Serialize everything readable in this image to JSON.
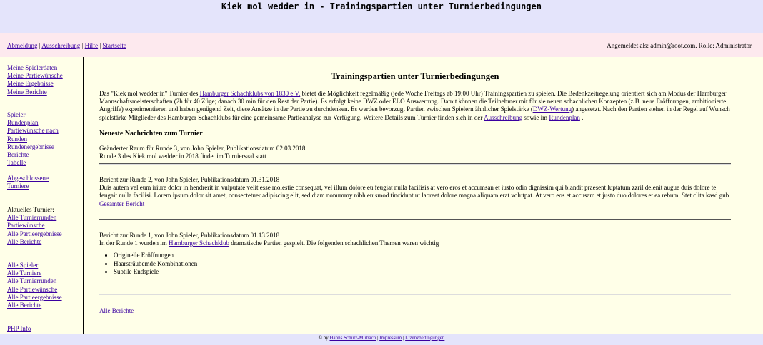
{
  "header": {
    "title": "Kiek mol wedder in - Trainingspartien unter Turnierbedingungen"
  },
  "nav": {
    "links": [
      "Abmeldung",
      "Ausschreibung",
      "Hilfe",
      "Startseite"
    ],
    "separator": " | ",
    "login_text": "Angemeldet als: admin@root.com. Rolle: Administrator"
  },
  "sidebar": {
    "group1": [
      "Meine Spielerdaten",
      "Meine Partiewünsche",
      "Meine Ergebnisse",
      "Meine Berichte"
    ],
    "group2": [
      "Spieler",
      "Rundenplan",
      "Partiewünsche nach Runden",
      "Rundenergebnisse",
      "Berichte",
      "Tabelle"
    ],
    "group3": [
      "Abgeschlossene Turniere"
    ],
    "current_label": "Aktuelles Turnier:",
    "group4": [
      "Alle Turnierrunden",
      "Partiewünsche",
      "Alle Partieergebnisse",
      "Alle Berichte"
    ],
    "group5": [
      "Alle Spieler",
      "Alle Turniere",
      "Alle Turnierrunden",
      "Alle Partiewünsche",
      "Alle Partieergebnisse",
      "Alle Berichte"
    ],
    "group6": [
      "PHP Info"
    ]
  },
  "main": {
    "title": "Trainingspartien unter Turnierbedingungen",
    "intro": {
      "p1": "Das \"Kiek mol wedder in\" Turnier des ",
      "link1": "Hamburger Schachklubs von 1830 e.V.",
      "p2": " bietet die Möglichkeit regelmäßig (jede Woche Freitags ab 19:00 Uhr) Trainingspartien zu spielen. Die Bedenkzeitregelung orientiert sich am Modus der Hamburger Mannschaftsmeisterschaften (2h für 40 Züge; danach 30 min für den Rest der Partie). Es erfolgt keine DWZ oder ELO Auswertung. Damit können die Teilnehmer mit für sie neuen schachlichen Konzepten (z.B. neue Eröffnungen, ambitionierte Angriffe) experimentieren und haben genügend Zeit, diese Ansätze in der Partie zu durchdenken. Es werden bevorzugt Partien zwischen Spielern ähnlicher Spielstärke (",
      "link2": "DWZ-Wertung",
      "p3": ") angesetzt. Nach den Partien stehen in der Regel auf Wunsch spielstärke Mitglieder des Hamburger Schachklubs für eine gemeinsame Partieanalyse zur Verfügung. Weitere Details zum Turnier finden sich in der ",
      "link3": "Ausschreibung",
      "p4": " sowie im ",
      "link4": "Rundenplan",
      "p5": " ."
    },
    "news_heading": "Neueste Nachrichten zum Turnier",
    "news": [
      {
        "headline": "Geänderter Raum für Runde 3, von John Spieler, Publikationsdatum 02.03.2018",
        "body": "Runde 3 des Kiek mol wedder in 2018 findet im Turniersaal statt"
      },
      {
        "headline": "Bericht zur Runde 2, von John Spieler, Publikationsdatum 01.31.2018",
        "body": "Duis autem vel eum iriure dolor in hendrerit in vulputate velit esse molestie consequat, vel illum dolore eu feugiat nulla facilisis at vero eros et accumsan et iusto odio dignissim qui blandit praesent luptatum zzril delenit augue duis dolore te feugait nulla facilisi. Lorem ipsum dolor sit amet, consectetuer adipiscing elit, sed diam nonummy nibh euismod tincidunt ut laoreet dolore magna aliquam erat volutpat. At vero eos et accusam et justo duo dolores et ea rebum. Stet clita kasd gub",
        "more": "Gesamter Bericht"
      },
      {
        "headline": "Bericht zur Runde 1, von John Spieler, Publikationsdatum 01.13.2018",
        "body_pre": "In der Runde 1 wurden im ",
        "body_link": "Hamburger Schachklub",
        "body_post": " dramatische Partien gespielt. Die folgenden schachlichen Themen waren wichtig",
        "items": [
          "Originelle Eröffnungen",
          "Haarsträubemde Kombinationen",
          "Subtile Endspiele"
        ]
      }
    ],
    "all_reports": "Alle Berichte"
  },
  "footer": {
    "prefix": "© by ",
    "author": "Hanns Schulz-Mirbach",
    "sep": " | ",
    "impressum": "Impressum",
    "license": "Lizenzbedingungen"
  }
}
